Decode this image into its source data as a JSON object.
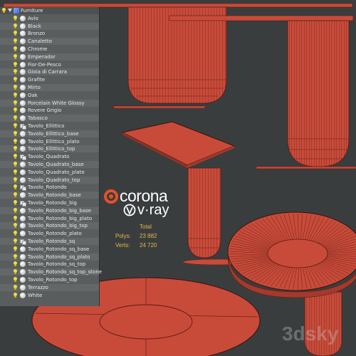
{
  "outliner": {
    "root": {
      "label": "Furniture",
      "icon": "layer-folder-icon"
    },
    "items": [
      {
        "label": "Avio",
        "icon": "material-sphere-icon"
      },
      {
        "label": "Black",
        "icon": "material-sphere-icon"
      },
      {
        "label": "Bronzo",
        "icon": "material-sphere-icon"
      },
      {
        "label": "Canaletto",
        "icon": "material-sphere-icon"
      },
      {
        "label": "Chrome",
        "icon": "material-sphere-icon"
      },
      {
        "label": "Emperador",
        "icon": "material-sphere-icon"
      },
      {
        "label": "Fior-De-Pesco",
        "icon": "material-sphere-icon"
      },
      {
        "label": "Gioia di Carrara",
        "icon": "material-sphere-icon"
      },
      {
        "label": "Grafite",
        "icon": "material-sphere-icon"
      },
      {
        "label": "Mirto",
        "icon": "material-sphere-icon"
      },
      {
        "label": "Oak",
        "icon": "material-sphere-icon"
      },
      {
        "label": "Porcelain White Glossy",
        "icon": "material-sphere-icon"
      },
      {
        "label": "Rovere Grigio",
        "icon": "material-sphere-icon"
      },
      {
        "label": "Tabasco",
        "icon": "material-sphere-icon"
      },
      {
        "label": "Tavolo_Ellittico",
        "icon": "group-object-icon"
      },
      {
        "label": "Tavolo_Ellittico_base",
        "icon": "material-sphere-icon"
      },
      {
        "label": "Tavolo_Ellittico_plato",
        "icon": "material-sphere-icon"
      },
      {
        "label": "Tavolo_Ellittico_top",
        "icon": "material-sphere-icon"
      },
      {
        "label": "Tavolo_Quadrato",
        "icon": "group-object-icon"
      },
      {
        "label": "Tavolo_Quadrato_base",
        "icon": "material-sphere-icon"
      },
      {
        "label": "Tavolo_Quadrato_plate",
        "icon": "material-sphere-icon"
      },
      {
        "label": "Tavolo_Quadrato_top",
        "icon": "material-sphere-icon"
      },
      {
        "label": "Tavolo_Rotondo",
        "icon": "group-object-icon"
      },
      {
        "label": "Tavolo_Rotondo_base",
        "icon": "material-sphere-icon"
      },
      {
        "label": "Tavolo_Rotondo_big",
        "icon": "group-object-icon"
      },
      {
        "label": "Tavolo_Rotondo_big_base",
        "icon": "material-sphere-icon"
      },
      {
        "label": "Tavolo_Rotondo_big_plato",
        "icon": "material-sphere-icon"
      },
      {
        "label": "Tavolo_Rotondo_big_top",
        "icon": "material-sphere-icon"
      },
      {
        "label": "Tavolo_Rotondo_plato",
        "icon": "material-sphere-icon"
      },
      {
        "label": "Tavolo_Rotondo_sq",
        "icon": "group-object-icon"
      },
      {
        "label": "Tavolo_Rotondo_sq_base",
        "icon": "material-sphere-icon"
      },
      {
        "label": "Tavolo_Rotondo_sq_plato",
        "icon": "material-sphere-icon"
      },
      {
        "label": "Tavolo_Rotondo_sq_top",
        "icon": "material-sphere-icon"
      },
      {
        "label": "Tavolo_Rotondo_sq_top_stone",
        "icon": "material-sphere-icon"
      },
      {
        "label": "Tavolo_Rotondo_top",
        "icon": "material-sphere-icon"
      },
      {
        "label": "Terrazzo",
        "icon": "material-sphere-icon"
      },
      {
        "label": "White",
        "icon": "material-sphere-icon"
      }
    ]
  },
  "branding": {
    "corona": "corona",
    "vray": "v·ray"
  },
  "stats": {
    "header": "Total",
    "polys_label": "Polys:",
    "polys_value": "23 882",
    "verts_label": "Verts:",
    "verts_value": "24 720"
  },
  "watermark": "3dsky",
  "colors": {
    "model_red": "#c84b3a",
    "wire": "#5a1a12",
    "viewport_bg": "#3a3d3e",
    "stats_text": "#e6b74a",
    "bulb": "#f4dd3a"
  }
}
